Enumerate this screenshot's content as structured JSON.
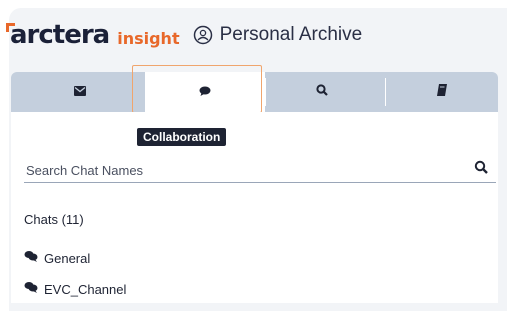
{
  "header": {
    "logo_arctera": "arctera",
    "logo_insight": "insight",
    "title": "Personal Archive"
  },
  "tabs": [
    {
      "icon": "envelope-icon",
      "active": false
    },
    {
      "icon": "chat-bubble-icon",
      "active": true
    },
    {
      "icon": "search-icon",
      "active": false
    },
    {
      "icon": "notebook-icon",
      "active": false
    }
  ],
  "tooltip": "Collaboration",
  "search": {
    "placeholder": "Search Chat Names",
    "value": ""
  },
  "chats": {
    "heading": "Chats (11)",
    "items": [
      {
        "label": "General",
        "icon": "chat-icon"
      },
      {
        "label": "EVC_Channel",
        "icon": "chat-icon"
      }
    ]
  },
  "colors": {
    "accent": "#e8682a",
    "tabbar": "#c4cfdd",
    "brand": "#1b2138"
  }
}
